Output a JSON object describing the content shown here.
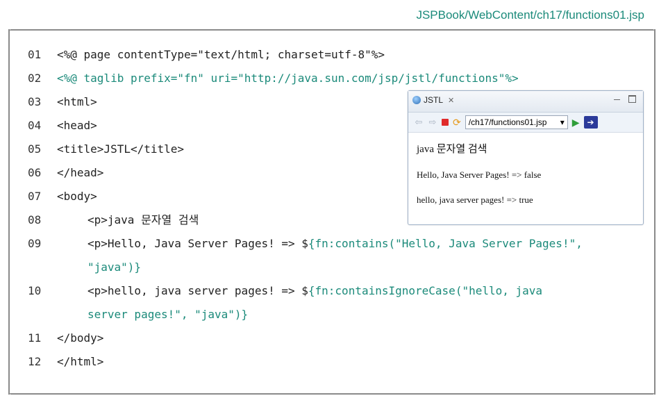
{
  "file_path": "JSPBook/WebContent/ch17/functions01.jsp",
  "code_lines": [
    {
      "num": "01",
      "text": "<%@ page contentType=\"text/html; charset=utf-8\"%>"
    },
    {
      "num": "02",
      "text": "<%@ taglib prefix=\"fn\" uri=\"http://java.sun.com/jsp/jstl/functions\"%>"
    },
    {
      "num": "03",
      "text": "<html>"
    },
    {
      "num": "04",
      "text": "<head>"
    },
    {
      "num": "05",
      "text": "<title>JSTL</title>"
    },
    {
      "num": "06",
      "text": "</head>"
    },
    {
      "num": "07",
      "text": "<body>"
    },
    {
      "num": "08",
      "text": "<p>java 문자열 검색"
    },
    {
      "num": "09",
      "pre": "<p>Hello, Java Server Pages! => $",
      "expr": "{fn:contains(\"Hello, Java Server Pages!\",",
      "cont": "\"java\")}"
    },
    {
      "num": "10",
      "pre": "<p>hello, java server pages! => $",
      "expr": "{fn:containsIgnoreCase(\"hello, java",
      "cont": "server pages!\", \"java\")}"
    },
    {
      "num": "11",
      "text": "</body>"
    },
    {
      "num": "12",
      "text": "</html>"
    }
  ],
  "browser": {
    "tab_label": "JSTL",
    "tab_close": "✕",
    "url": "/ch17/functions01.jsp",
    "output_heading": "java 문자열 검색",
    "output_line1": "Hello, Java Server Pages! => false",
    "output_line2": "hello, java server pages! => true"
  },
  "colors": {
    "accent_teal": "#1b8a7a",
    "stop_red": "#e02b2b",
    "go_green": "#2e9e3a"
  }
}
